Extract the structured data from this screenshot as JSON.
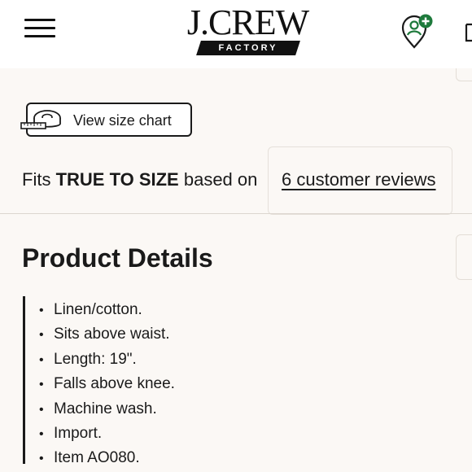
{
  "header": {
    "logo_main": "J.CREW",
    "logo_sub": "FACTORY"
  },
  "size_chart": {
    "button_label": "View size chart"
  },
  "fit": {
    "prefix": "Fits ",
    "rating": "TRUE TO SIZE",
    "suffix": " based on",
    "reviews_link": "6 customer reviews"
  },
  "product_details": {
    "title": "Product Details",
    "items": [
      "Linen/cotton.",
      "Sits above waist.",
      "Length: 19\".",
      "Falls above knee.",
      "Machine wash.",
      "Import.",
      "Item AO080."
    ]
  },
  "icons": {
    "menu": "hamburger-menu-icon",
    "account": "account-add-icon",
    "bag": "shopping-bag-icon",
    "size_chart": "measuring-tape-icon"
  },
  "colors": {
    "background": "#fbf8f5",
    "header": "#ffffff",
    "text": "#1a1a1a",
    "accent_green": "#1e7a3c"
  }
}
